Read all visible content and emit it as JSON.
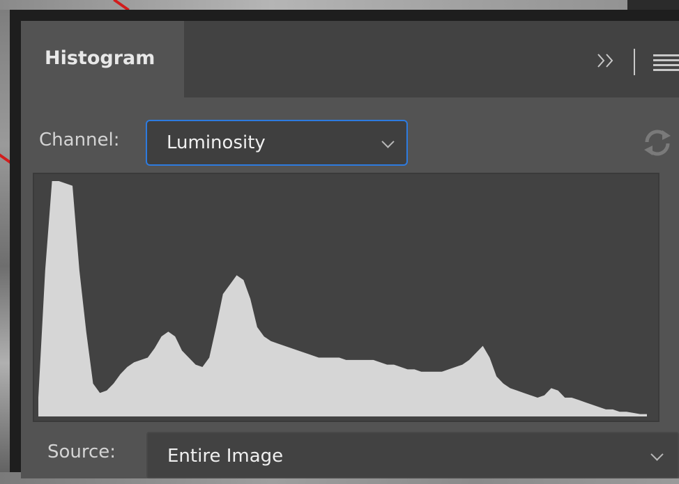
{
  "panel": {
    "tab_label": "Histogram",
    "collapse_icon": "double-chevron-right-icon",
    "menu_icon": "hamburger-menu-icon"
  },
  "channel": {
    "label": "Channel:",
    "value": "Luminosity",
    "refresh_icon": "refresh-icon"
  },
  "histogram": {
    "fill_color": "#d6d6d6",
    "background_color": "#424242",
    "levels": [
      0.08,
      0.62,
      1.0,
      1.0,
      0.99,
      0.98,
      0.62,
      0.36,
      0.14,
      0.1,
      0.11,
      0.14,
      0.18,
      0.21,
      0.23,
      0.24,
      0.25,
      0.29,
      0.34,
      0.36,
      0.34,
      0.28,
      0.25,
      0.22,
      0.21,
      0.25,
      0.38,
      0.52,
      0.56,
      0.6,
      0.58,
      0.5,
      0.38,
      0.34,
      0.32,
      0.31,
      0.3,
      0.29,
      0.28,
      0.27,
      0.26,
      0.25,
      0.25,
      0.25,
      0.25,
      0.24,
      0.24,
      0.24,
      0.24,
      0.24,
      0.23,
      0.22,
      0.22,
      0.21,
      0.2,
      0.2,
      0.19,
      0.19,
      0.19,
      0.19,
      0.2,
      0.21,
      0.22,
      0.24,
      0.27,
      0.3,
      0.25,
      0.17,
      0.14,
      0.12,
      0.11,
      0.1,
      0.09,
      0.08,
      0.09,
      0.12,
      0.11,
      0.08,
      0.08,
      0.07,
      0.06,
      0.05,
      0.04,
      0.03,
      0.03,
      0.02,
      0.02,
      0.015,
      0.01,
      0.01
    ]
  },
  "source": {
    "label": "Source:",
    "value": "Entire Image"
  }
}
